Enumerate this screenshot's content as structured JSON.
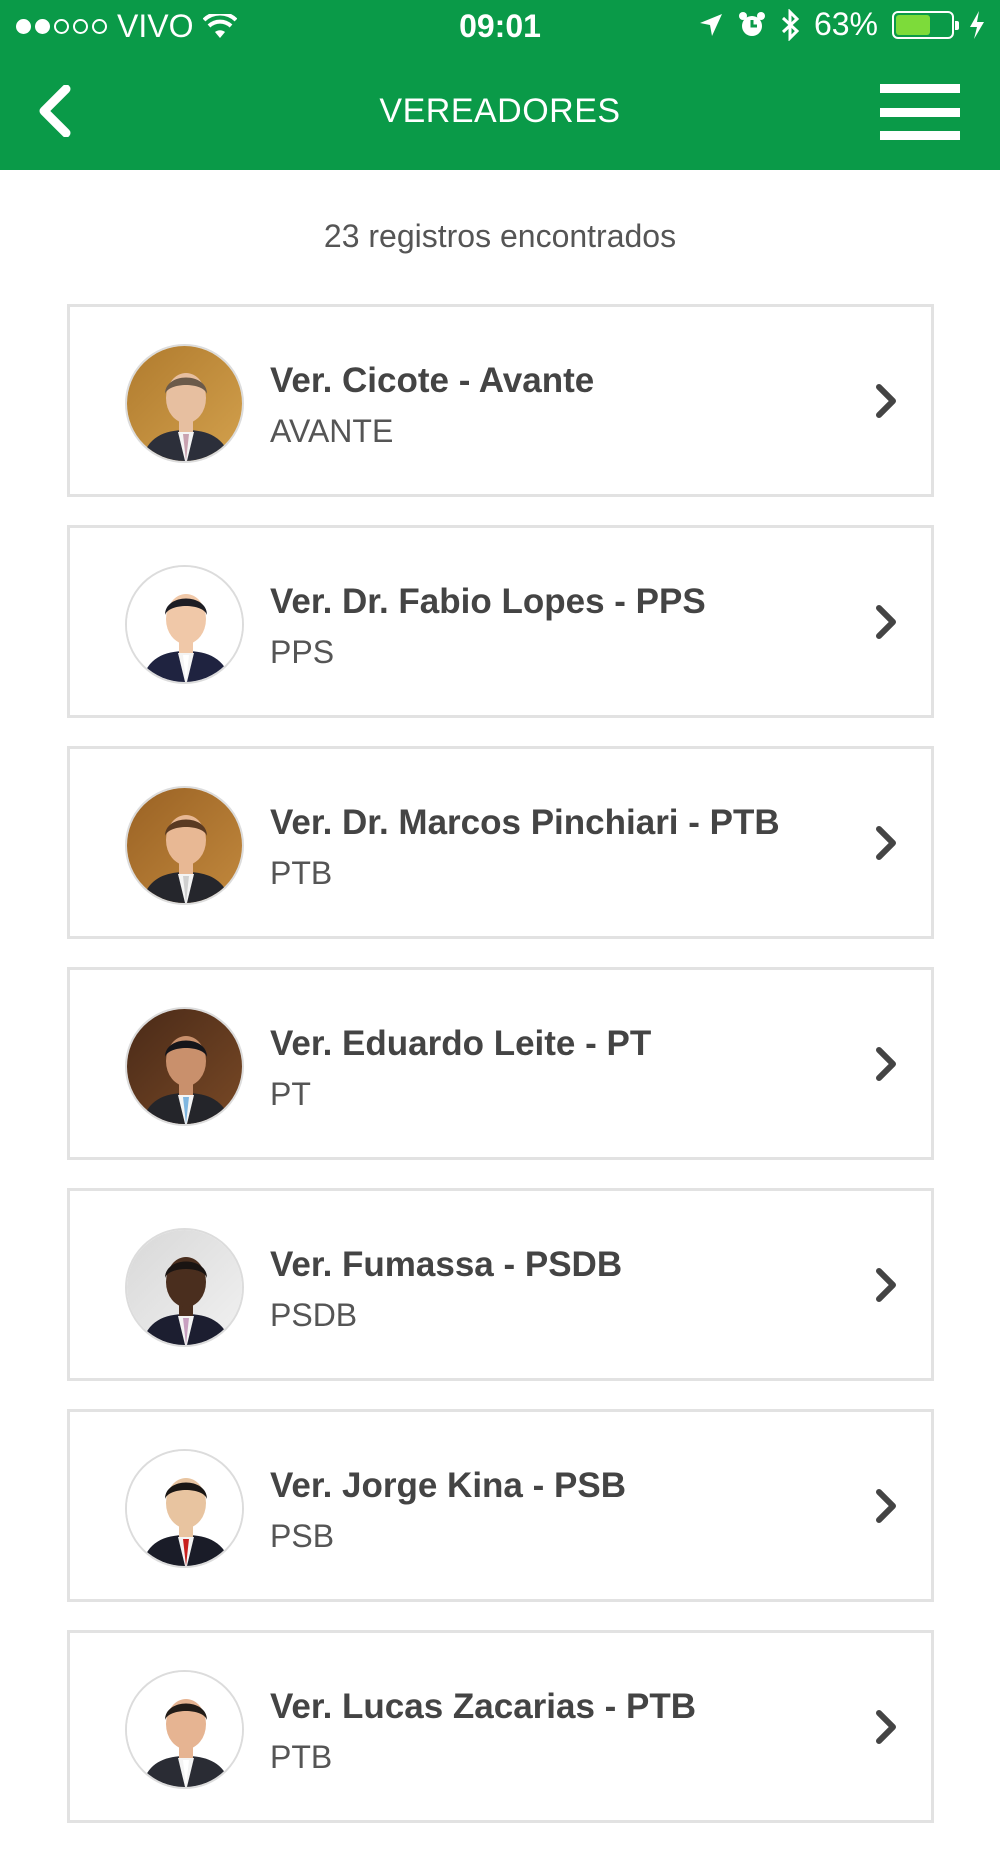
{
  "status_bar": {
    "carrier": "VIVO",
    "time": "09:01",
    "battery": "63%",
    "battery_level": 0.63,
    "icons": [
      "signal-dots-icon",
      "wifi-icon",
      "location-arrow-icon",
      "alarm-icon",
      "bluetooth-icon",
      "battery-icon",
      "charging-bolt-icon"
    ]
  },
  "header": {
    "title": "VEREADORES",
    "back_icon": "chevron-left-icon",
    "menu_icon": "hamburger-menu-icon",
    "color": "#0a9a48"
  },
  "results": {
    "count_text": "23 registros encontrados"
  },
  "councillors": [
    {
      "name": "Ver. Cicote - Avante",
      "party": "AVANTE",
      "photo": "photo-cicote"
    },
    {
      "name": "Ver. Dr. Fabio Lopes - PPS",
      "party": "PPS",
      "photo": "photo-fabio-lopes"
    },
    {
      "name": "Ver. Dr. Marcos Pinchiari - PTB",
      "party": "PTB",
      "photo": "photo-marcos-pinchiari"
    },
    {
      "name": "Ver. Eduardo Leite - PT",
      "party": "PT",
      "photo": "photo-eduardo-leite"
    },
    {
      "name": "Ver. Fumassa - PSDB",
      "party": "PSDB",
      "photo": "photo-fumassa"
    },
    {
      "name": "Ver. Jorge Kina - PSB",
      "party": "PSB",
      "photo": "photo-jorge-kina"
    },
    {
      "name": "Ver. Lucas Zacarias - PTB",
      "party": "PTB",
      "photo": "photo-lucas-zacarias"
    }
  ]
}
